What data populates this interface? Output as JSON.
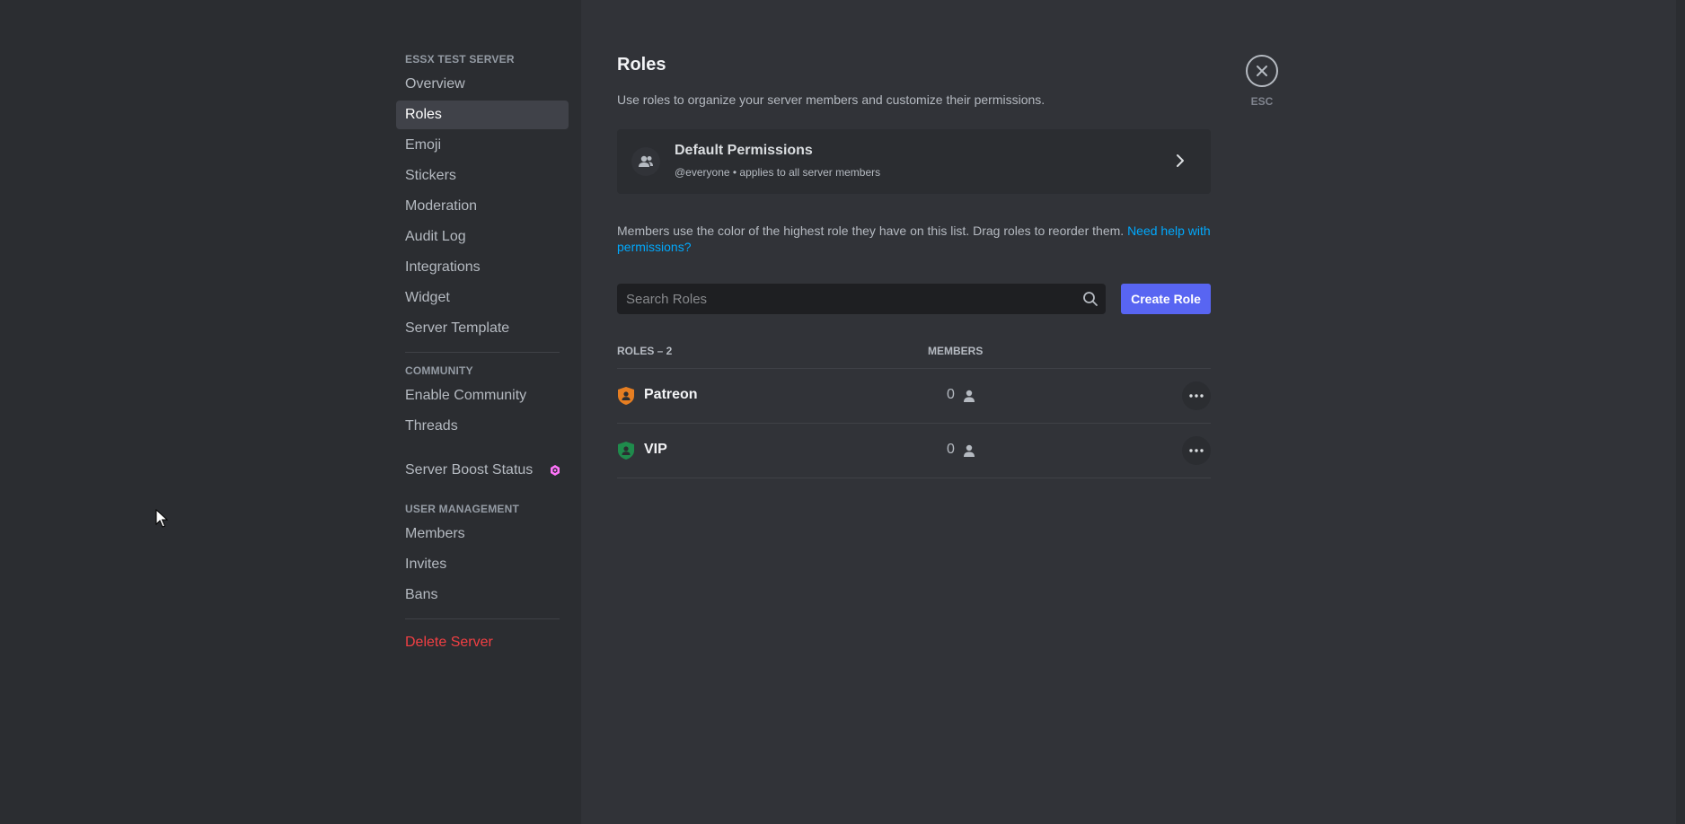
{
  "sidebar": {
    "server_section": "ESSX TEST SERVER",
    "server_items": [
      {
        "label": "Overview"
      },
      {
        "label": "Roles"
      },
      {
        "label": "Emoji"
      },
      {
        "label": "Stickers"
      },
      {
        "label": "Moderation"
      },
      {
        "label": "Audit Log"
      },
      {
        "label": "Integrations"
      },
      {
        "label": "Widget"
      },
      {
        "label": "Server Template"
      }
    ],
    "selected_item": "Roles",
    "community_section": "COMMUNITY",
    "community_items": [
      {
        "label": "Enable Community"
      },
      {
        "label": "Threads"
      }
    ],
    "boost_label": "Server Boost Status",
    "user_section": "USER MANAGEMENT",
    "user_items": [
      {
        "label": "Members"
      },
      {
        "label": "Invites"
      },
      {
        "label": "Bans"
      }
    ],
    "delete_label": "Delete Server"
  },
  "main": {
    "title": "Roles",
    "description": "Use roles to organize your server members and customize their permissions.",
    "default_permissions": {
      "title": "Default Permissions",
      "subtitle": "@everyone • applies to all server members"
    },
    "help_text": "Members use the color of the highest role they have on this list. Drag roles to reorder them.",
    "help_link": "Need help with permissions?",
    "search_placeholder": "Search Roles",
    "create_role_label": "Create Role",
    "table": {
      "roles_header": "ROLES – 2",
      "members_header": "MEMBERS",
      "rows": [
        {
          "name": "Patreon",
          "members": "0",
          "color": "#e67e22"
        },
        {
          "name": "VIP",
          "members": "0",
          "color": "#1f8b4c"
        }
      ]
    }
  },
  "close": {
    "label": "ESC"
  },
  "colors": {
    "accent": "#5865f2",
    "danger": "#f23f43",
    "link": "#00a8fc",
    "boost": "#ff73fa"
  }
}
